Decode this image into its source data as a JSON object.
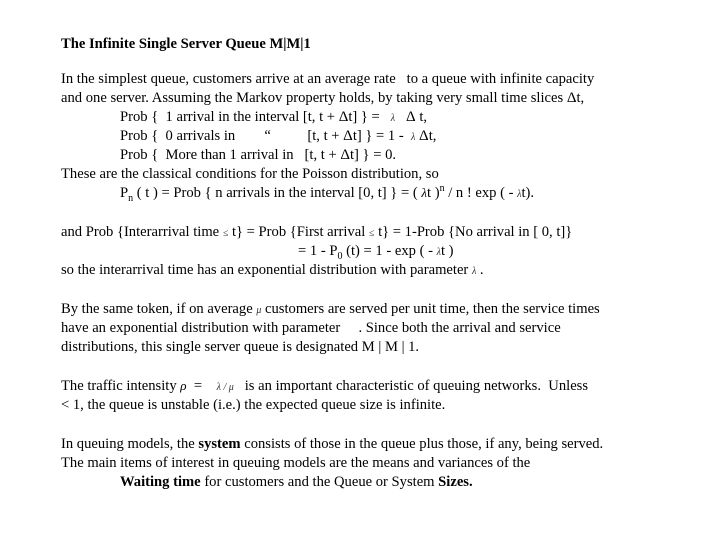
{
  "title": "The Infinite Single Server Queue M|M|1",
  "symbols": {
    "lambda": "λ",
    "mu": "μ",
    "rho": "ρ",
    "delta": "Δ",
    "leq": "≤"
  },
  "para1": {
    "l1a": "In the simplest queue, customers arrive at an average rate ",
    "l1b": "to a queue with infinite capacity",
    "l2a": "and one server. Assuming the Markov property holds, by taking very small time slices ",
    "l2b": "t,",
    "p1a": "Prob {  1 arrival in the interval [t, t + ",
    "p1b": "t] } = ",
    "p1c": "t,",
    "p2a": "Prob {  0 arrivals in        “          [t, t + ",
    "p2b": "t] } = 1 - ",
    "p2c": "t,",
    "p3a": "Prob {  More than 1 arrival in   [t, t + ",
    "p3b": "t] } = 0.",
    "l3": "These are the classical conditions for the Poisson distribution, so",
    "pn_a": "P",
    "pn_sub": "n",
    "pn_b": " ( t ) = Prob { n arrivals in the interval [0, t] } = ( ",
    "pn_c": "t )",
    "pn_sup": "n",
    "pn_d": " / n ! exp ( - ",
    "pn_e": "t)."
  },
  "para2": {
    "l1a": "and Prob {Interarrival time ",
    "l1b": " t} = Prob {First arrival ",
    "l1c": " t} = 1-Prob {No arrival in [ 0, t]}",
    "l2a": "= 1 - P",
    "l2sub": "0",
    "l2b": " (t) = 1 - exp ( - ",
    "l2c": "t )",
    "l3a": "so the interarrival time has an exponential distribution with parameter ",
    "l3b": " ."
  },
  "para3": {
    "l1a": "By the same token, if on average ",
    "l1b": " customers are served per unit time, then the service times",
    "l2a": "have an exponential distribution with parameter     . Since both the arrival and service",
    "l3": "distributions, this single server queue is designated M | M | 1."
  },
  "para4": {
    "l1a": "The traffic intensity ",
    "l1b": "  =    ",
    "l1c": " / ",
    "l1d": "   is an important characteristic of queuing networks.  Unless",
    "l2": "< 1, the queue is unstable (i.e.) the expected queue size is infinite."
  },
  "para5": {
    "l1a": "In queuing models, the ",
    "l1bold": "system",
    "l1b": " consists of those in the queue plus those, if any, being served.",
    "l2": "The main items of interest in queuing models are the means and variances of the",
    "l3bold1": "Waiting time",
    "l3a": " for customers and the Queue or System ",
    "l3bold2": "Sizes."
  }
}
